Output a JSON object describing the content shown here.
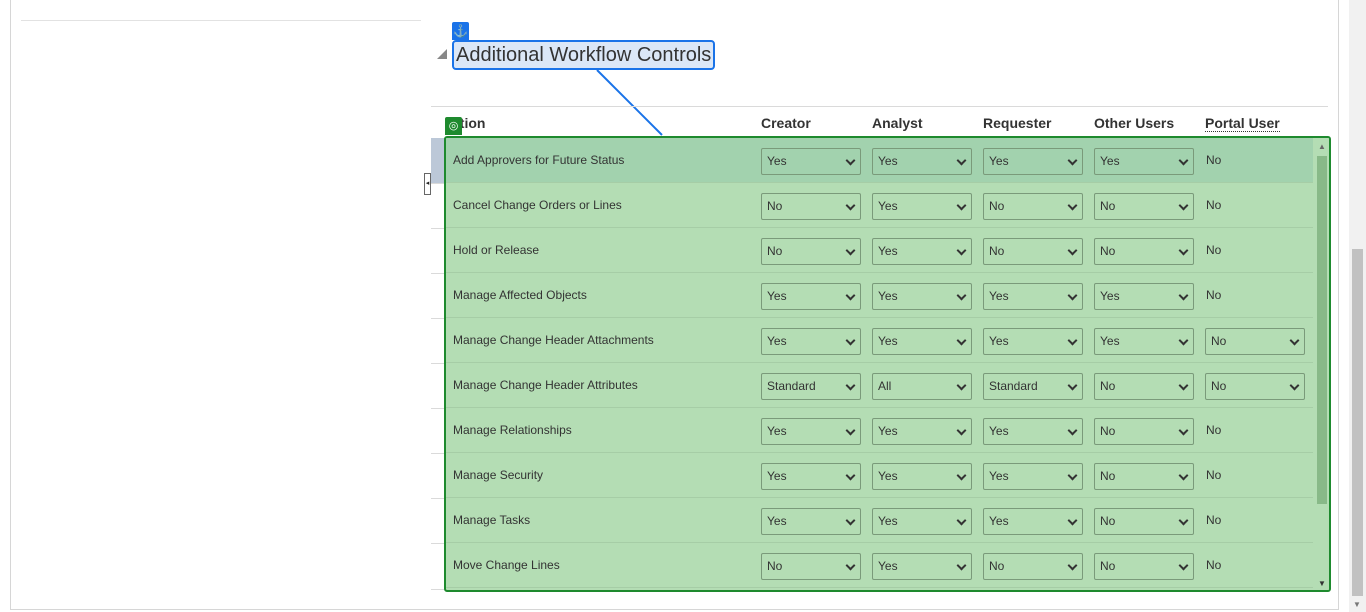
{
  "section": {
    "title": "Additional Workflow Controls"
  },
  "icons": {
    "anchor": "⚓",
    "target": "◎",
    "collapse": "◂",
    "scroll_up": "▲",
    "scroll_down": "▼"
  },
  "table": {
    "headers": {
      "action": "ction",
      "creator": "Creator",
      "analyst": "Analyst",
      "requester": "Requester",
      "other_users": "Other Users",
      "portal_user": "Portal User"
    },
    "rows": [
      {
        "action": "Add Approvers for Future Status",
        "creator": "Yes",
        "analyst": "Yes",
        "requester": "Yes",
        "other_users": "Yes",
        "portal_user": "No"
      },
      {
        "action": "Cancel Change Orders or Lines",
        "creator": "No",
        "analyst": "Yes",
        "requester": "No",
        "other_users": "No",
        "portal_user": "No"
      },
      {
        "action": "Hold or Release",
        "creator": "No",
        "analyst": "Yes",
        "requester": "No",
        "other_users": "No",
        "portal_user": "No"
      },
      {
        "action": "Manage Affected Objects",
        "creator": "Yes",
        "analyst": "Yes",
        "requester": "Yes",
        "other_users": "Yes",
        "portal_user": "No"
      },
      {
        "action": "Manage Change Header Attachments",
        "creator": "Yes",
        "analyst": "Yes",
        "requester": "Yes",
        "other_users": "Yes",
        "portal_user": "No"
      },
      {
        "action": "Manage Change Header Attributes",
        "creator": "Standard",
        "analyst": "All",
        "requester": "Standard",
        "other_users": "No",
        "portal_user": "No"
      },
      {
        "action": "Manage Relationships",
        "creator": "Yes",
        "analyst": "Yes",
        "requester": "Yes",
        "other_users": "No",
        "portal_user": "No"
      },
      {
        "action": "Manage Security",
        "creator": "Yes",
        "analyst": "Yes",
        "requester": "Yes",
        "other_users": "No",
        "portal_user": "No"
      },
      {
        "action": "Manage Tasks",
        "creator": "Yes",
        "analyst": "Yes",
        "requester": "Yes",
        "other_users": "No",
        "portal_user": "No"
      },
      {
        "action": "Move Change Lines",
        "creator": "No",
        "analyst": "Yes",
        "requester": "No",
        "other_users": "No",
        "portal_user": "No"
      }
    ]
  }
}
